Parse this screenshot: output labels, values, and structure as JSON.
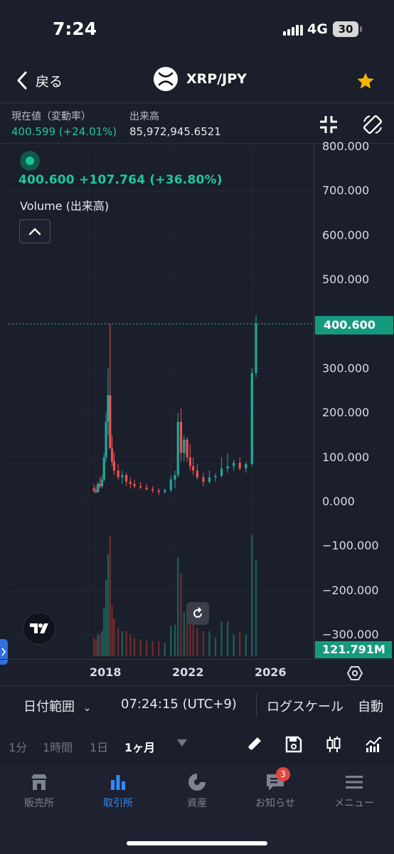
{
  "status_bar": {
    "time": "7:24",
    "network": "4G",
    "battery": "30"
  },
  "nav": {
    "back_label": "戻る",
    "pair": "XRP/JPY",
    "favorite_icon": "star-icon"
  },
  "quote": {
    "current_label": "現在値（変動率）",
    "current_value": "400.599 (+24.01%)",
    "volume_label": "出来高",
    "volume_value": "85,972,945.6521"
  },
  "legend": {
    "price_line": "400.600  +107.764 (+36.80%)",
    "volume_label": "Volume (出来高)"
  },
  "axis": {
    "y_ticks": [
      "800.000",
      "700.000",
      "600.000",
      "500.000",
      "400.600",
      "300.000",
      "200.000",
      "100.000",
      "0.000",
      "−100.000",
      "−200.000",
      "−300.000"
    ],
    "price_tag": "400.600",
    "volume_tag": "121.791M",
    "x_ticks": [
      "2018",
      "2022",
      "2026"
    ]
  },
  "range_bar": {
    "date_range": "日付範囲",
    "time": "07:24:15 (UTC+9)",
    "log_scale": "ログスケール",
    "auto": "自動"
  },
  "timeframes": {
    "m1": "1分",
    "h1": "1時間",
    "d1": "1日",
    "mo1": "1ヶ月"
  },
  "tabs": {
    "shop": "販売所",
    "exchange": "取引所",
    "assets": "資産",
    "notices": "お知らせ",
    "menu": "メニュー",
    "notice_badge": "3"
  },
  "colors": {
    "up": "#26a69a",
    "down": "#ef5350",
    "accent": "#169a7f",
    "active_tab": "#2f8bff"
  },
  "chart_data": {
    "type": "candlestick",
    "interval": "1ヶ月",
    "y_ticks": [
      800,
      700,
      600,
      500,
      300,
      200,
      100,
      0,
      -100,
      -200,
      -300
    ],
    "x_ticks": [
      "2018",
      "2022",
      "2026"
    ],
    "ylim": [
      -330,
      830
    ],
    "last_price": 400.6,
    "change": 107.764,
    "change_pct": 36.8,
    "volume_last": "121.791M",
    "candles": [
      {
        "t": 2017.0,
        "o": 30,
        "h": 40,
        "l": 20,
        "c": 25
      },
      {
        "t": 2017.1,
        "o": 25,
        "h": 35,
        "l": 18,
        "c": 22
      },
      {
        "t": 2017.2,
        "o": 22,
        "h": 45,
        "l": 20,
        "c": 40
      },
      {
        "t": 2017.3,
        "o": 40,
        "h": 55,
        "l": 30,
        "c": 35
      },
      {
        "t": 2017.4,
        "o": 35,
        "h": 60,
        "l": 30,
        "c": 50
      },
      {
        "t": 2017.5,
        "o": 50,
        "h": 110,
        "l": 45,
        "c": 100
      },
      {
        "t": 2017.6,
        "o": 100,
        "h": 200,
        "l": 90,
        "c": 180
      },
      {
        "t": 2017.7,
        "o": 180,
        "h": 300,
        "l": 150,
        "c": 240
      },
      {
        "t": 2017.8,
        "o": 240,
        "h": 400,
        "l": 200,
        "c": 120
      },
      {
        "t": 2017.9,
        "o": 120,
        "h": 150,
        "l": 80,
        "c": 90
      },
      {
        "t": 2018.0,
        "o": 90,
        "h": 110,
        "l": 60,
        "c": 70
      },
      {
        "t": 2018.2,
        "o": 70,
        "h": 85,
        "l": 50,
        "c": 55
      },
      {
        "t": 2018.4,
        "o": 55,
        "h": 70,
        "l": 40,
        "c": 60
      },
      {
        "t": 2018.6,
        "o": 60,
        "h": 65,
        "l": 35,
        "c": 45
      },
      {
        "t": 2018.8,
        "o": 45,
        "h": 55,
        "l": 30,
        "c": 40
      },
      {
        "t": 2019.0,
        "o": 40,
        "h": 50,
        "l": 30,
        "c": 35
      },
      {
        "t": 2019.3,
        "o": 35,
        "h": 45,
        "l": 28,
        "c": 32
      },
      {
        "t": 2019.6,
        "o": 32,
        "h": 40,
        "l": 25,
        "c": 28
      },
      {
        "t": 2019.9,
        "o": 28,
        "h": 35,
        "l": 20,
        "c": 25
      },
      {
        "t": 2020.2,
        "o": 25,
        "h": 30,
        "l": 15,
        "c": 22
      },
      {
        "t": 2020.5,
        "o": 22,
        "h": 30,
        "l": 18,
        "c": 26
      },
      {
        "t": 2020.8,
        "o": 26,
        "h": 60,
        "l": 22,
        "c": 50
      },
      {
        "t": 2021.0,
        "o": 50,
        "h": 70,
        "l": 30,
        "c": 60
      },
      {
        "t": 2021.15,
        "o": 60,
        "h": 200,
        "l": 55,
        "c": 180
      },
      {
        "t": 2021.3,
        "o": 180,
        "h": 210,
        "l": 90,
        "c": 110
      },
      {
        "t": 2021.45,
        "o": 110,
        "h": 150,
        "l": 90,
        "c": 140
      },
      {
        "t": 2021.6,
        "o": 140,
        "h": 145,
        "l": 90,
        "c": 100
      },
      {
        "t": 2021.75,
        "o": 100,
        "h": 130,
        "l": 70,
        "c": 80
      },
      {
        "t": 2021.9,
        "o": 80,
        "h": 100,
        "l": 60,
        "c": 70
      },
      {
        "t": 2022.1,
        "o": 70,
        "h": 85,
        "l": 50,
        "c": 55
      },
      {
        "t": 2022.4,
        "o": 55,
        "h": 65,
        "l": 35,
        "c": 45
      },
      {
        "t": 2022.7,
        "o": 45,
        "h": 70,
        "l": 40,
        "c": 55
      },
      {
        "t": 2023.0,
        "o": 55,
        "h": 65,
        "l": 45,
        "c": 58
      },
      {
        "t": 2023.3,
        "o": 58,
        "h": 100,
        "l": 55,
        "c": 75
      },
      {
        "t": 2023.6,
        "o": 75,
        "h": 110,
        "l": 65,
        "c": 80
      },
      {
        "t": 2023.9,
        "o": 80,
        "h": 95,
        "l": 70,
        "c": 88
      },
      {
        "t": 2024.2,
        "o": 88,
        "h": 100,
        "l": 70,
        "c": 75
      },
      {
        "t": 2024.5,
        "o": 75,
        "h": 90,
        "l": 65,
        "c": 85
      },
      {
        "t": 2024.8,
        "o": 85,
        "h": 300,
        "l": 80,
        "c": 290
      },
      {
        "t": 2025.0,
        "o": 290,
        "h": 420,
        "l": 280,
        "c": 400.6
      }
    ]
  }
}
